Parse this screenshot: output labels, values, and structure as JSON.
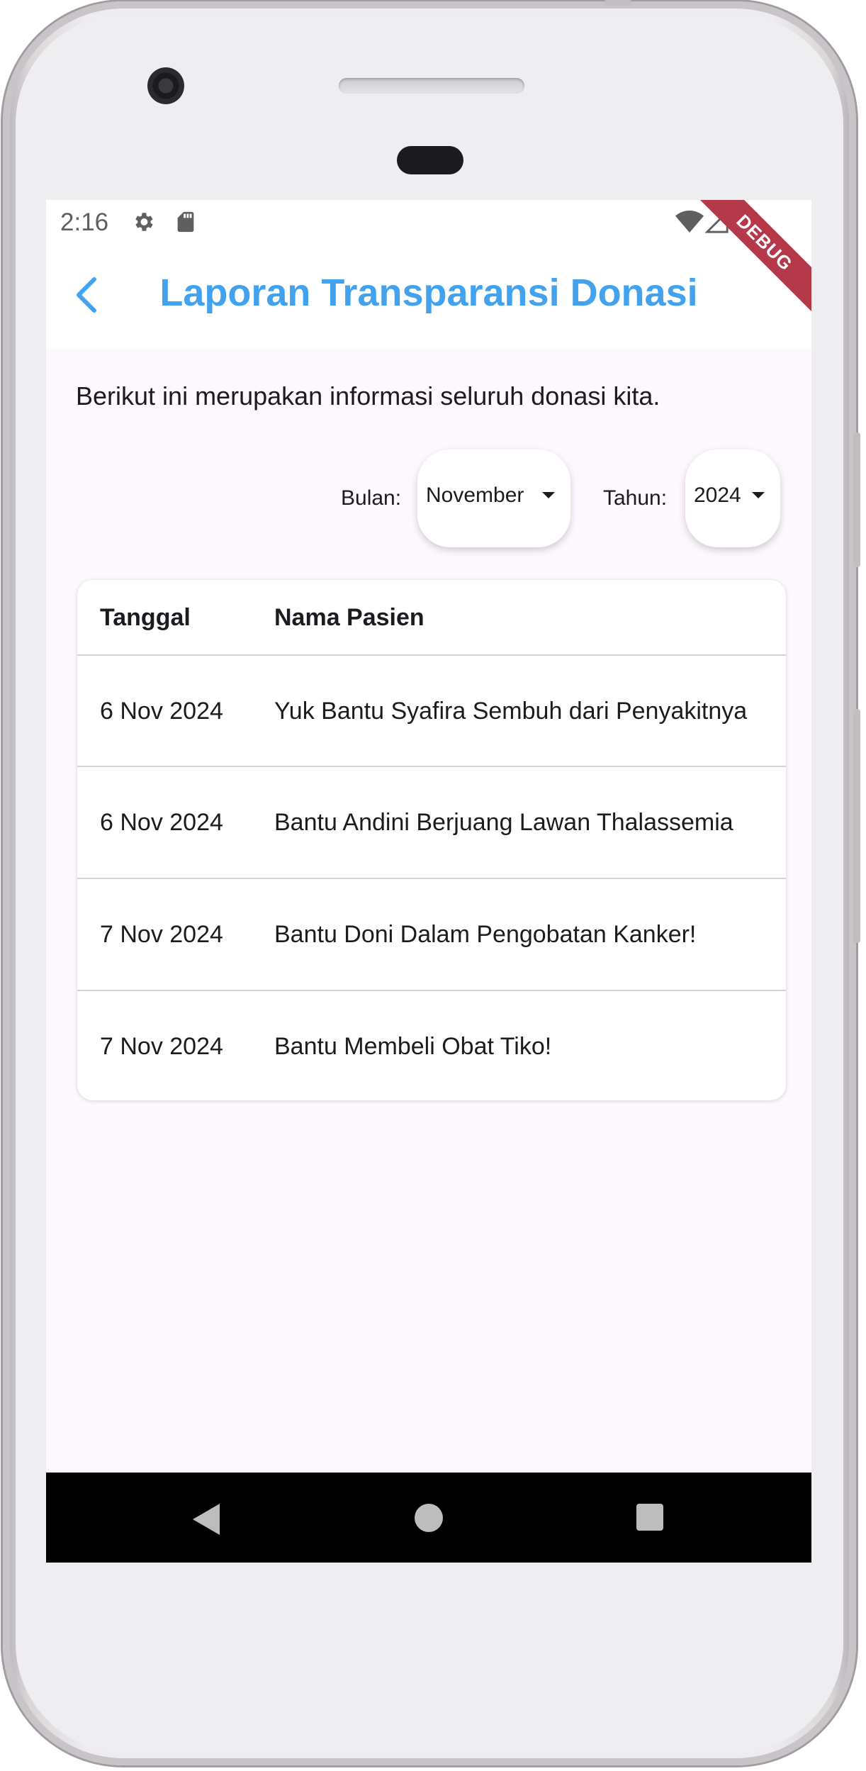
{
  "status_bar": {
    "time": "2:16",
    "icons": [
      "gear-icon",
      "sd-card-icon",
      "wifi-icon",
      "signal-icon",
      "battery-icon"
    ]
  },
  "app_bar": {
    "title": "Laporan Transparansi Donasi",
    "back_icon": "chevron-left-icon",
    "title_color": "#43a2ee"
  },
  "debug_banner": "DEBUG",
  "intro_text": "Berikut ini merupakan informasi seluruh donasi kita.",
  "filters": {
    "month_label": "Bulan:",
    "month_value": "November",
    "year_label": "Tahun:",
    "year_value": "2024"
  },
  "table": {
    "headers": [
      "Tanggal",
      "Nama Pasien"
    ],
    "rows": [
      {
        "date": "6 Nov 2024",
        "name": "Yuk Bantu Syafira Sembuh dari Penyakitnya"
      },
      {
        "date": "6 Nov 2024",
        "name": "Bantu Andini Berjuang Lawan Thalassemia"
      },
      {
        "date": "7 Nov 2024",
        "name": "Bantu Doni Dalam Pengobatan Kanker!"
      },
      {
        "date": "7 Nov 2024",
        "name": "Bantu Membeli Obat Tiko!"
      }
    ]
  },
  "nav_bar": {
    "buttons": [
      "nav-back-icon",
      "nav-home-icon",
      "nav-recents-icon"
    ]
  },
  "colors": {
    "accent": "#43a2ee",
    "background": "#fdf7fe",
    "debug": "#b5394a"
  }
}
